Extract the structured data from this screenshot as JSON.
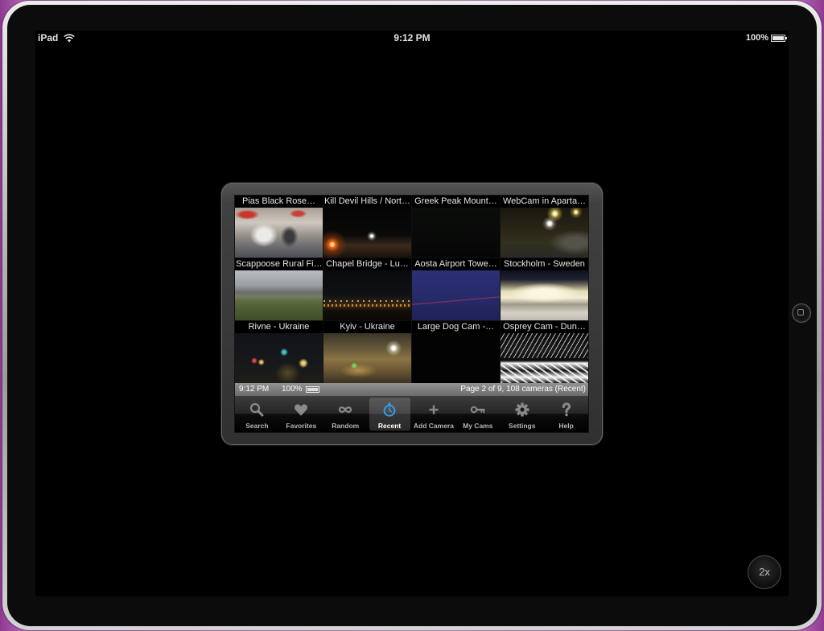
{
  "device_status_bar": {
    "device": "iPad",
    "time": "9:12 PM",
    "battery": "100%",
    "icons": [
      "wifi-icon",
      "battery-icon"
    ]
  },
  "app": {
    "cameras": [
      {
        "title": "Pias Black Rose…"
      },
      {
        "title": "Kill Devil Hills / Nort…"
      },
      {
        "title": "Greek Peak Mount…"
      },
      {
        "title": "WebCam in Aparta…"
      },
      {
        "title": "Scappoose Rural Fi…"
      },
      {
        "title": "Chapel Bridge - Lu…"
      },
      {
        "title": "Aosta Airport Towe…"
      },
      {
        "title": "Stockholm - Sweden"
      },
      {
        "title": "Rivne - Ukraine"
      },
      {
        "title": "Kyiv - Ukraine"
      },
      {
        "title": "Large Dog Cam -…"
      },
      {
        "title": "Osprey Cam - Dun…"
      }
    ],
    "status_strip": {
      "time": "9:12 PM",
      "battery": "100%",
      "page_info": "Page 2 of 9, 108 cameras (Recent)"
    },
    "tab_bar": {
      "selected": "Recent",
      "tabs": [
        {
          "label": "Search",
          "icon": "magnifier-icon"
        },
        {
          "label": "Favorites",
          "icon": "heart-icon"
        },
        {
          "label": "Random",
          "icon": "infinity-icon"
        },
        {
          "label": "Recent",
          "icon": "stopwatch-icon"
        },
        {
          "label": "Add Camera",
          "icon": "plus-icon"
        },
        {
          "label": "My Cams",
          "icon": "key-icon"
        },
        {
          "label": "Settings",
          "icon": "gear-icon"
        },
        {
          "label": "Help",
          "icon": "question-mark-icon"
        }
      ]
    }
  },
  "zoom_button": {
    "label": "2x"
  },
  "colors": {
    "accent": "#3d9ae6",
    "tab_icon": "#8a8a8a",
    "desktop_background": "#b666b9"
  }
}
